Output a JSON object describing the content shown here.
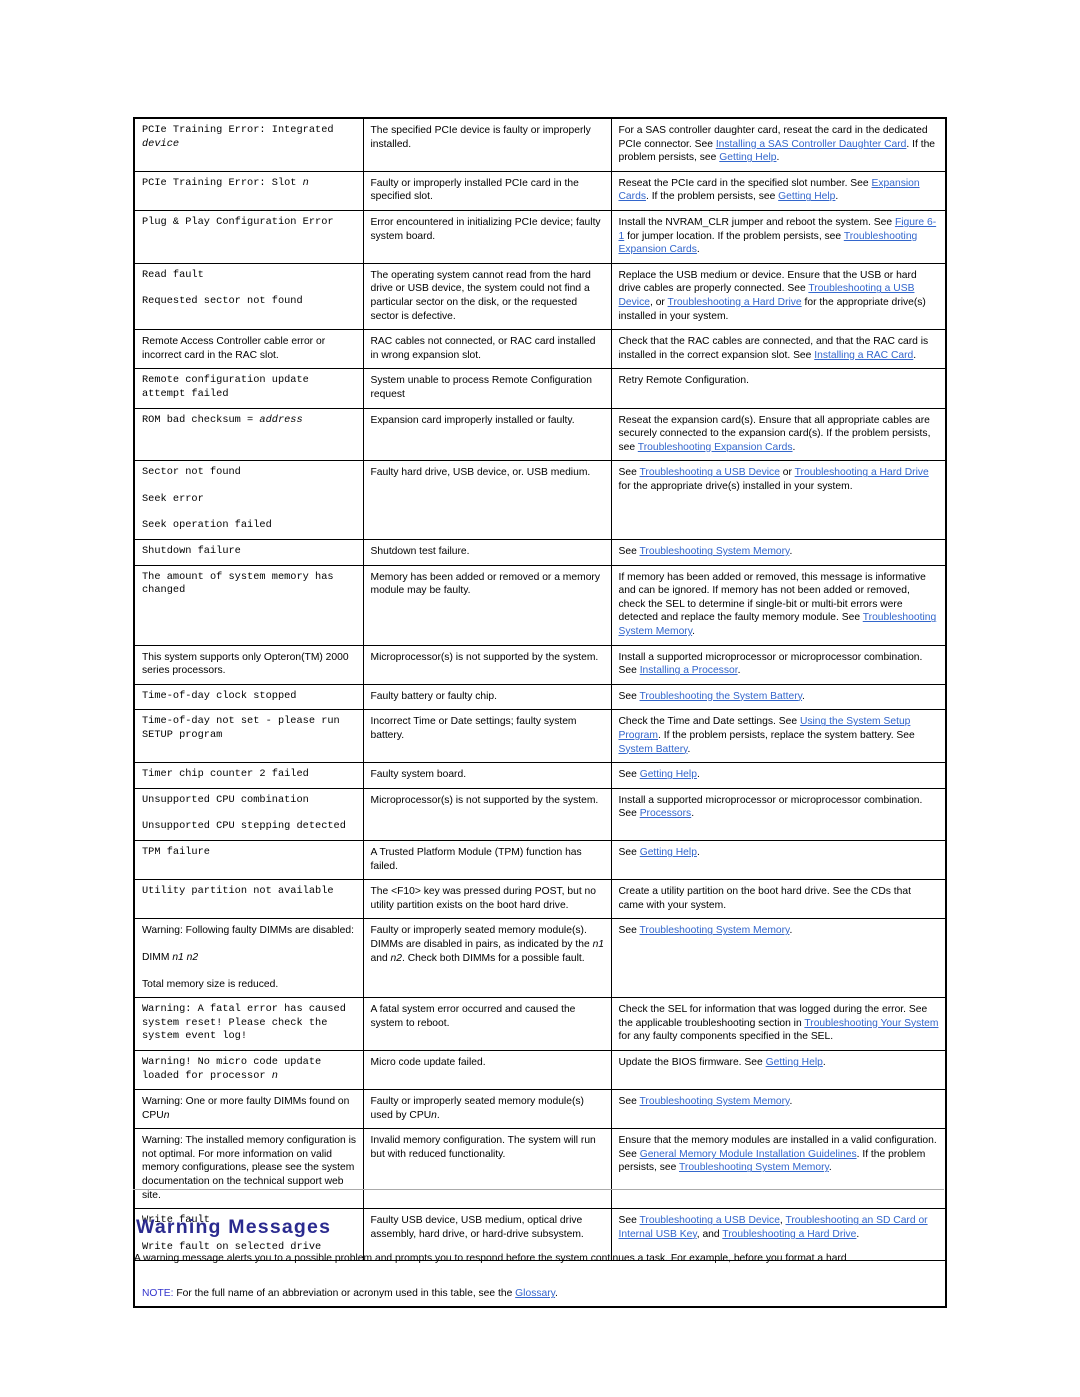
{
  "document": {
    "section_heading": "Warning Messages",
    "body_paragraph": "A warning message alerts you to a possible problem and prompts you to respond before the system continues a task. For example, before you format a hard",
    "note_label": "NOTE:",
    "note_text": " For the full name of an abbreviation or acronym used in this table, see the ",
    "note_link": "Glossary",
    "note_end": ".",
    "link_color": "#3366CC",
    "heading_color": "#2B2B8F",
    "note_label_color": "#3333CC"
  },
  "table": {
    "rows": [
      {
        "message_style": "code",
        "message": "PCIe Training Error: Integrated ",
        "message_italic": "device",
        "cause": "The specified PCIe device is faulty or improperly installed.",
        "action_parts": [
          {
            "t": "For a SAS controller daughter card, reseat the card in the dedicated PCIe connector. See ",
            "link": false
          },
          {
            "t": "Installing a SAS Controller Daughter Card",
            "link": true
          },
          {
            "t": ". If the problem persists, see ",
            "link": false
          },
          {
            "t": "Getting Help",
            "link": true
          },
          {
            "t": ".",
            "link": false
          }
        ]
      },
      {
        "message_style": "code",
        "message": "PCIe Training Error: Slot ",
        "message_italic": "n",
        "cause": "Faulty or improperly installed PCIe card in the specified slot.",
        "action_parts": [
          {
            "t": "Reseat the PCIe card in the specified slot number. See ",
            "link": false
          },
          {
            "t": "Expansion Cards",
            "link": true
          },
          {
            "t": ". If the problem persists, see ",
            "link": false
          },
          {
            "t": "Getting Help",
            "link": true
          },
          {
            "t": ".",
            "link": false
          }
        ]
      },
      {
        "message_style": "code",
        "message": "Plug & Play Configuration Error",
        "message_italic": "",
        "cause": "Error encountered in initializing PCIe device; faulty system board.",
        "action_parts": [
          {
            "t": "Install the NVRAM_CLR jumper and reboot the system. See ",
            "link": false
          },
          {
            "t": "Figure 6-1",
            "link": true
          },
          {
            "t": " for jumper location. If the problem persists, see ",
            "link": false
          },
          {
            "t": "Troubleshooting Expansion Cards",
            "link": true
          },
          {
            "t": ".",
            "link": false
          }
        ]
      },
      {
        "message_style": "code",
        "message": "Read fault",
        "message_italic": "",
        "message_extra": "Requested sector not found",
        "cause": "The operating system cannot read from the hard drive or USB device, the system could not find a particular sector on the disk, or the requested sector is defective.",
        "action_parts": [
          {
            "t": "Replace the USB medium or device. Ensure that the USB or hard drive cables are properly connected. See ",
            "link": false
          },
          {
            "t": "Troubleshooting a USB Device",
            "link": true
          },
          {
            "t": ", or ",
            "link": false
          },
          {
            "t": "Troubleshooting a Hard Drive",
            "link": true
          },
          {
            "t": " for the appropriate drive(s) installed in your system.",
            "link": false
          }
        ]
      },
      {
        "message_style": "sans",
        "message": "Remote Access Controller cable error or incorrect card in the RAC slot.",
        "message_italic": "",
        "cause": "RAC cables not connected, or RAC card installed in wrong expansion slot.",
        "action_parts": [
          {
            "t": "Check that the RAC cables are connected, and that the RAC card is installed in the correct expansion slot. See ",
            "link": false
          },
          {
            "t": "Installing a RAC Card",
            "link": true
          },
          {
            "t": ".",
            "link": false
          }
        ]
      },
      {
        "message_style": "code",
        "message": "Remote configuration update attempt failed",
        "message_italic": "",
        "cause": "System unable to process Remote Configuration request",
        "action_parts": [
          {
            "t": "Retry Remote Configuration.",
            "link": false
          }
        ]
      },
      {
        "message_style": "code",
        "message": "ROM bad checksum = ",
        "message_italic": "address",
        "cause": "Expansion card improperly installed or faulty.",
        "action_parts": [
          {
            "t": "Reseat the expansion card(s). Ensure that all appropriate cables are securely connected to the expansion card(s). If the problem persists, see ",
            "link": false
          },
          {
            "t": "Troubleshooting Expansion Cards",
            "link": true
          },
          {
            "t": ".",
            "link": false
          }
        ]
      },
      {
        "message_style": "code",
        "message": "Sector not found",
        "message_italic": "",
        "message_extra": "Seek error",
        "message_extra2": "Seek operation failed",
        "cause": "Faulty hard drive, USB device, or. USB medium.",
        "action_parts": [
          {
            "t": "See ",
            "link": false
          },
          {
            "t": "Troubleshooting a USB Device",
            "link": true
          },
          {
            "t": " or ",
            "link": false
          },
          {
            "t": "Troubleshooting a Hard Drive",
            "link": true
          },
          {
            "t": " for the appropriate drive(s) installed in your system.",
            "link": false
          }
        ]
      },
      {
        "message_style": "code",
        "message": "Shutdown failure",
        "message_italic": "",
        "cause": "Shutdown test failure.",
        "action_parts": [
          {
            "t": "See ",
            "link": false
          },
          {
            "t": "Troubleshooting System Memory",
            "link": true
          },
          {
            "t": ".",
            "link": false
          }
        ]
      },
      {
        "message_style": "code",
        "message": "The amount of system memory has changed",
        "message_italic": "",
        "cause": "Memory has been added or removed or a memory module may be faulty.",
        "action_parts": [
          {
            "t": "If memory has been added or removed, this message is informative and can be ignored. If memory has not been added or removed, check the SEL to determine if single-bit or multi-bit errors were detected and replace the faulty memory module. See ",
            "link": false
          },
          {
            "t": "Troubleshooting System Memory",
            "link": true
          },
          {
            "t": ".",
            "link": false
          }
        ]
      },
      {
        "message_style": "sans",
        "message": "This system supports only Opteron(TM) 2000 series processors.",
        "message_italic": "",
        "cause": "Microprocessor(s) is not supported by the system.",
        "action_parts": [
          {
            "t": "Install a supported microprocessor or microprocessor combination. See ",
            "link": false
          },
          {
            "t": "Installing a Processor",
            "link": true
          },
          {
            "t": ".",
            "link": false
          }
        ]
      },
      {
        "message_style": "code",
        "message": "Time-of-day clock stopped",
        "message_italic": "",
        "cause": "Faulty battery or faulty chip.",
        "action_parts": [
          {
            "t": "See ",
            "link": false
          },
          {
            "t": "Troubleshooting the System Battery",
            "link": true
          },
          {
            "t": ".",
            "link": false
          }
        ]
      },
      {
        "message_style": "code",
        "message": "Time-of-day not set - please run SETUP program",
        "message_italic": "",
        "cause": "Incorrect Time or Date settings; faulty system battery.",
        "action_parts": [
          {
            "t": "Check the Time and Date settings. See ",
            "link": false
          },
          {
            "t": "Using the System Setup Program",
            "link": true
          },
          {
            "t": ". If the problem persists, replace the system battery. See ",
            "link": false
          },
          {
            "t": "System Battery",
            "link": true
          },
          {
            "t": ".",
            "link": false
          }
        ]
      },
      {
        "message_style": "code",
        "message": "Timer chip counter 2 failed",
        "message_italic": "",
        "cause": "Faulty system board.",
        "action_parts": [
          {
            "t": "See ",
            "link": false
          },
          {
            "t": "Getting Help",
            "link": true
          },
          {
            "t": ".",
            "link": false
          }
        ]
      },
      {
        "message_style": "code",
        "message": "Unsupported CPU combination",
        "message_italic": "",
        "message_extra": "Unsupported CPU stepping detected",
        "cause": "Microprocessor(s) is not supported by the system.",
        "action_parts": [
          {
            "t": "Install a supported microprocessor or microprocessor combination. See ",
            "link": false
          },
          {
            "t": "Processors",
            "link": true
          },
          {
            "t": ".",
            "link": false
          }
        ]
      },
      {
        "message_style": "code",
        "message": "TPM failure",
        "message_italic": "",
        "cause": "A Trusted Platform Module (TPM) function has failed.",
        "action_parts": [
          {
            "t": "See ",
            "link": false
          },
          {
            "t": "Getting Help",
            "link": true
          },
          {
            "t": ".",
            "link": false
          }
        ]
      },
      {
        "message_style": "code",
        "message": "Utility partition not available",
        "message_italic": "",
        "cause": "The <F10> key was pressed during POST, but no utility partition exists on the boot hard drive.",
        "action_parts": [
          {
            "t": "Create a utility partition on the boot hard drive. See the CDs that came with your system.",
            "link": false
          }
        ]
      },
      {
        "message_style": "sans",
        "message": "Warning: Following faulty DIMMs are disabled:",
        "message_italic": "",
        "message_dimm_prefix": "DIMM ",
        "message_dimm_italic": "n1 n2",
        "message_extra2": "Total memory size is reduced.",
        "cause_parts": [
          {
            "t": "Faulty or improperly seated memory module(s). DIMMs are disabled in pairs, as indicated by the ",
            "i": false
          },
          {
            "t": "n1",
            "i": true
          },
          {
            "t": " and ",
            "i": false
          },
          {
            "t": "n2",
            "i": true
          },
          {
            "t": ". Check both DIMMs for a possible fault.",
            "i": false
          }
        ],
        "action_parts": [
          {
            "t": "See ",
            "link": false
          },
          {
            "t": "Troubleshooting System Memory",
            "link": true
          },
          {
            "t": ".",
            "link": false
          }
        ]
      },
      {
        "message_style": "code",
        "message": "Warning: A fatal error has caused system reset! Please check the system event log!",
        "message_italic": "",
        "cause": "A fatal system error occurred and caused the system to reboot.",
        "action_parts": [
          {
            "t": "Check the SEL for information that was logged during the error. See the applicable troubleshooting section in ",
            "link": false
          },
          {
            "t": "Troubleshooting Your System",
            "link": true
          },
          {
            "t": " for any faulty components specified in the SEL.",
            "link": false
          }
        ]
      },
      {
        "message_style": "code",
        "message": "Warning! No micro code update loaded for processor ",
        "message_italic": "n",
        "cause": "Micro code update failed.",
        "action_parts": [
          {
            "t": "Update the BIOS firmware. See ",
            "link": false
          },
          {
            "t": "Getting Help",
            "link": true
          },
          {
            "t": ".",
            "link": false
          }
        ]
      },
      {
        "message_style": "sans",
        "message": "Warning: One or more faulty DIMMs found on CPU",
        "message_italic": "n",
        "cause_parts": [
          {
            "t": "Faulty or improperly seated memory module(s) used by CPU",
            "i": false
          },
          {
            "t": "n",
            "i": true
          },
          {
            "t": ".",
            "i": false
          }
        ],
        "action_parts": [
          {
            "t": "See ",
            "link": false
          },
          {
            "t": "Troubleshooting System Memory",
            "link": true
          },
          {
            "t": ".",
            "link": false
          }
        ]
      },
      {
        "message_style": "sans",
        "message": "Warning: The installed memory configuration is not optimal. For more information on valid memory configurations, please see the system documentation on the technical support web site.",
        "message_italic": "",
        "cause": "Invalid memory configuration. The system will run but with reduced functionality.",
        "action_parts": [
          {
            "t": "Ensure that the memory modules are installed in a valid configuration. See ",
            "link": false
          },
          {
            "t": "General Memory Module Installation Guidelines",
            "link": true
          },
          {
            "t": ". If the problem persists, see ",
            "link": false
          },
          {
            "t": "Troubleshooting System Memory",
            "link": true
          },
          {
            "t": ".",
            "link": false
          }
        ]
      },
      {
        "message_style": "code",
        "message": "Write fault",
        "message_italic": "",
        "message_extra": "Write fault on selected drive",
        "cause": "Faulty USB device, USB medium, optical drive assembly, hard drive, or hard-drive subsystem.",
        "action_parts": [
          {
            "t": "See ",
            "link": false
          },
          {
            "t": "Troubleshooting a USB Device",
            "link": true
          },
          {
            "t": ", ",
            "link": false
          },
          {
            "t": "Troubleshooting an SD Card or Internal USB Key",
            "link": true
          },
          {
            "t": ", and ",
            "link": false
          },
          {
            "t": "Troubleshooting a Hard Drive",
            "link": true
          },
          {
            "t": ".",
            "link": false
          }
        ]
      }
    ]
  }
}
